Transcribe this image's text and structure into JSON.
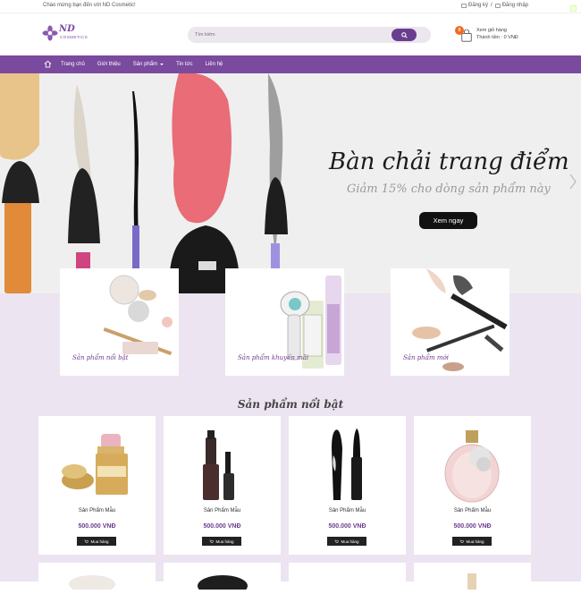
{
  "topbar": {
    "welcome": "Chào mừng bạn đến với ND Cosmetic!",
    "register": "Đăng ký",
    "separator": "/",
    "login": "Đăng nhập"
  },
  "header": {
    "logo_main": "ND",
    "logo_sub": "COSMETICS",
    "search_placeholder": "Tìm kiếm",
    "cart_count": "0",
    "cart_label": "Xem giỏ hàng",
    "cart_total": "Thành tiền : 0 VNĐ"
  },
  "nav": {
    "items": [
      {
        "label": "Trang chủ"
      },
      {
        "label": "Giới thiệu"
      },
      {
        "label": "Sản phẩm"
      },
      {
        "label": "Tin tức"
      },
      {
        "label": "Liên hệ"
      }
    ]
  },
  "banner": {
    "headline": "Bàn chải trang điểm",
    "subline": "Giảm 15% cho dòng sản phẩm này",
    "cta": "Xem ngay"
  },
  "promos": [
    {
      "caption": "Sản phẩm nổi bật"
    },
    {
      "caption": "Sản phẩm khuyến mãi"
    },
    {
      "caption": "Sản phẩm mới"
    }
  ],
  "featured": {
    "title": "Sản phẩm nổi bật",
    "products": [
      {
        "name": "Sản Phẩm Mẫu",
        "price": "500.000 VNĐ",
        "buy": "Mua hàng"
      },
      {
        "name": "Sản Phẩm Mẫu",
        "price": "500.000 VNĐ",
        "buy": "Mua hàng"
      },
      {
        "name": "Sản Phẩm Mẫu",
        "price": "500.000 VNĐ",
        "buy": "Mua hàng"
      },
      {
        "name": "Sản Phẩm Mẫu",
        "price": "500.000 VNĐ",
        "buy": "Mua hàng"
      }
    ]
  },
  "colors": {
    "brand_purple": "#7a4a9e",
    "lavender_bg": "#ece4f1",
    "cart_badge": "#f26b21"
  }
}
